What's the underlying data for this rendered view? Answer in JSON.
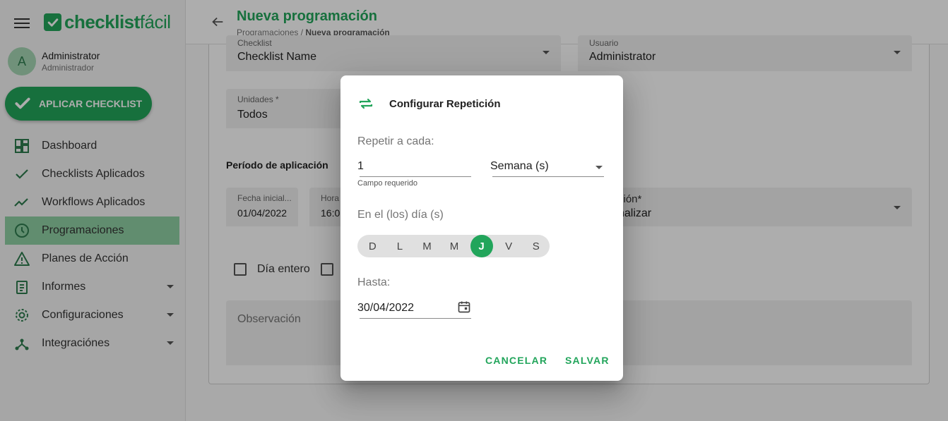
{
  "sidebar": {
    "logo_bold": "checklist",
    "logo_light": "fácil",
    "user": {
      "initial": "A",
      "name": "Administrator",
      "role": "Administrador"
    },
    "apply_button": "APLICAR CHECKLIST",
    "items": [
      {
        "label": "Dashboard",
        "icon": "dashboard-icon",
        "active": false,
        "expandable": false
      },
      {
        "label": "Checklists Aplicados",
        "icon": "check-icon",
        "active": false,
        "expandable": false
      },
      {
        "label": "Workflows Aplicados",
        "icon": "trend-icon",
        "active": false,
        "expandable": false
      },
      {
        "label": "Programaciones",
        "icon": "clock-icon",
        "active": true,
        "expandable": false
      },
      {
        "label": "Planes de Acción",
        "icon": "warning-icon",
        "active": false,
        "expandable": false
      },
      {
        "label": "Informes",
        "icon": "report-icon",
        "active": false,
        "expandable": true
      },
      {
        "label": "Configuraciones",
        "icon": "gear-icon",
        "active": false,
        "expandable": true
      },
      {
        "label": "Integraciónes",
        "icon": "hub-icon",
        "active": false,
        "expandable": true
      }
    ],
    "active_color": "#8fd0a4"
  },
  "header": {
    "title": "Nueva programación",
    "breadcrumb_parent": "Programaciones /",
    "breadcrumb_current": "Nueva programación"
  },
  "form": {
    "checklist": {
      "label": "Checklist",
      "value": "Checklist Name"
    },
    "usuario": {
      "label": "Usuario",
      "value": "Administrator"
    },
    "unidades": {
      "label": "Unidades *",
      "value": "Todos"
    },
    "period_title": "Período de aplicación",
    "fecha_inicial": {
      "label": "Fecha inicial...",
      "value": "01/04/2022"
    },
    "hora": {
      "label": "Hora",
      "value": "16:0"
    },
    "repeticion": {
      "label": "ción*",
      "value": "nalizar"
    },
    "dia_entero": "Día entero",
    "observacion_placeholder": "Observación"
  },
  "dialog": {
    "title": "Configurar Repetición",
    "repeat_label": "Repetir a cada:",
    "repeat_value": "1",
    "required_hint": "Campo requerido",
    "unit_value": "Semana (s)",
    "days_label": "En el (los) día (s)",
    "days": [
      {
        "letter": "D",
        "selected": false
      },
      {
        "letter": "L",
        "selected": false
      },
      {
        "letter": "M",
        "selected": false
      },
      {
        "letter": "M",
        "selected": false
      },
      {
        "letter": "J",
        "selected": true
      },
      {
        "letter": "V",
        "selected": false
      },
      {
        "letter": "S",
        "selected": false
      }
    ],
    "until_label": "Hasta:",
    "until_value": "30/04/2022",
    "cancel": "CANCELAR",
    "save": "SALVAR"
  },
  "colors": {
    "brand": "#22a55b",
    "overlay": "rgba(0,0,0,0.32)"
  }
}
